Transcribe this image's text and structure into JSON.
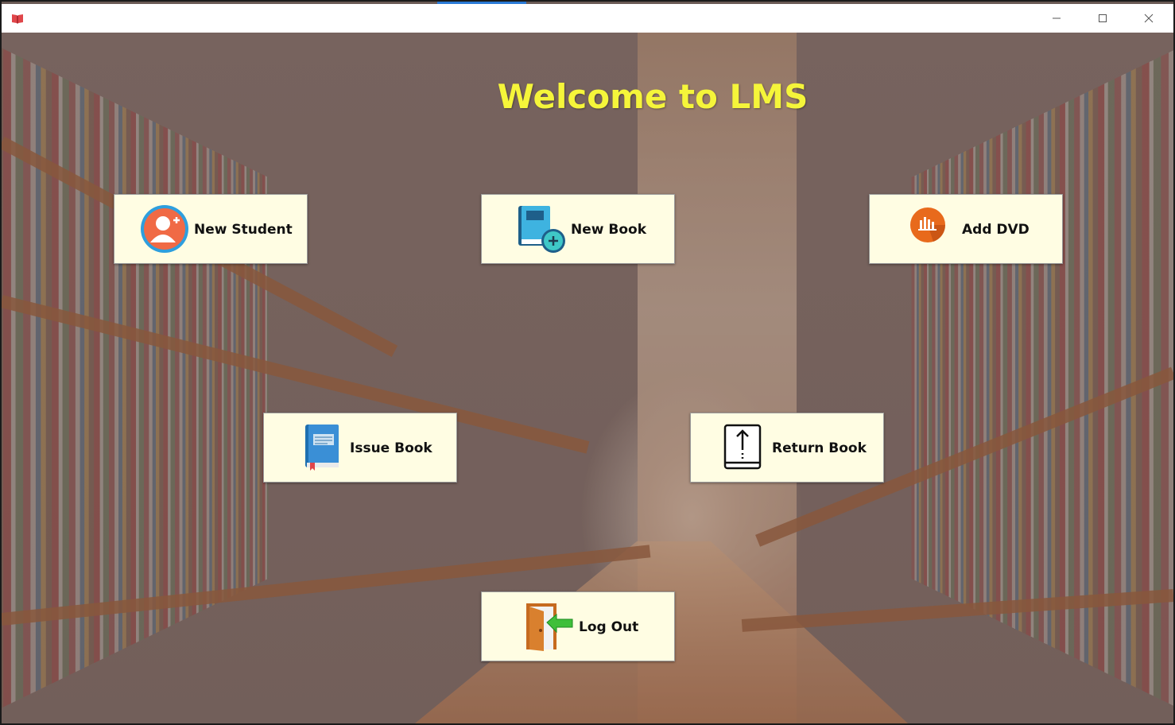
{
  "window": {
    "title": "",
    "controls": {
      "minimize": "minimize-icon",
      "maximize": "maximize-icon",
      "close": "close-icon"
    }
  },
  "header": {
    "title": "Welcome to LMS",
    "title_color": "#f5f53a"
  },
  "menu": {
    "new_student": {
      "label": "New Student",
      "icon": "add-user-icon"
    },
    "new_book": {
      "label": "New Book",
      "icon": "add-book-icon"
    },
    "add_dvd": {
      "label": "Add DVD",
      "icon": "dvd-icon"
    },
    "issue_book": {
      "label": "Issue Book",
      "icon": "book-icon"
    },
    "return_book": {
      "label": "Return Book",
      "icon": "return-book-icon"
    },
    "log_out": {
      "label": "Log Out",
      "icon": "logout-door-icon"
    }
  },
  "colors": {
    "button_bg": "#fffde3",
    "accent": "#2a7ad6"
  }
}
